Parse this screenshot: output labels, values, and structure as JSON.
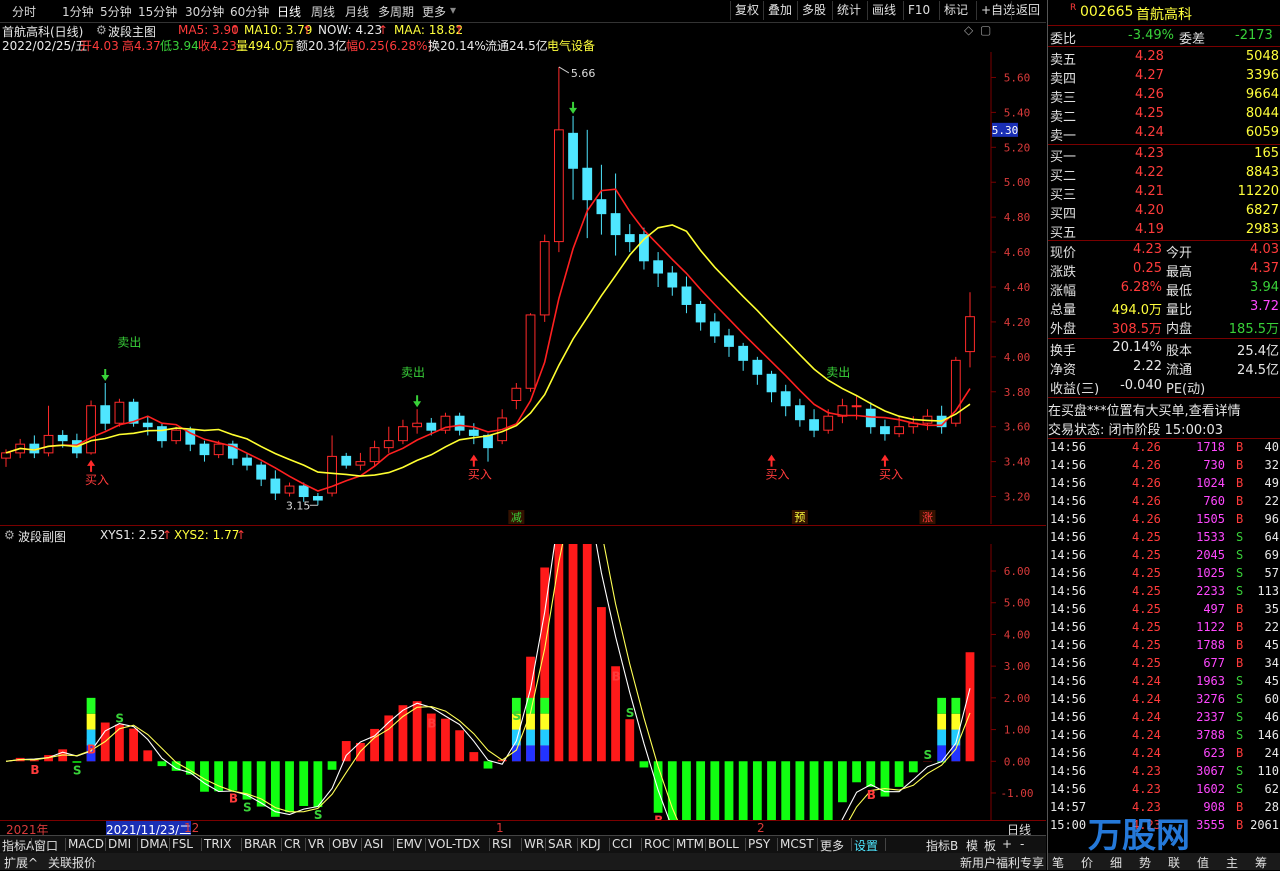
{
  "toolbar": {
    "periods": [
      "分时",
      "1分钟",
      "5分钟",
      "15分钟",
      "30分钟",
      "60分钟",
      "日线",
      "周线",
      "月线",
      "多周期",
      "更多"
    ],
    "buttons": [
      "复权",
      "叠加",
      "多股",
      "统计",
      "画线",
      "F10",
      "标记",
      "+自选",
      "返回"
    ]
  },
  "main_info": {
    "stock": "首航高科(日线)",
    "indicator": "波段主图",
    "ma5": "MA5: 3.90",
    "ma10": "MA10: 3.79",
    "now": "NOW: 4.23",
    "maa": "MAA: 18.82",
    "date": "2022/02/25/五",
    "open": "开4.03",
    "high": "高4.37",
    "low": "低3.94",
    "close": "收4.23",
    "vol": "量494.0万",
    "amount": "额20.3亿",
    "range": "幅0.25(6.28%)",
    "turnover": "换20.14%",
    "float": "流通24.5亿",
    "sector": "电气设备"
  },
  "main_chart": {
    "y_ticks": [
      "5.60",
      "5.40",
      "5.20",
      "5.00",
      "4.80",
      "4.60",
      "4.40",
      "4.20",
      "4.00",
      "3.80",
      "3.60",
      "3.40",
      "3.20"
    ],
    "crosshair_price": "5.30",
    "peak_label": "5.66",
    "low_label": "3.15",
    "sell_labels": [
      "卖出",
      "卖出",
      "卖出"
    ],
    "buy_labels": [
      "买入",
      "买入",
      "买入",
      "买入"
    ],
    "markers": [
      "减",
      "预",
      "涨"
    ]
  },
  "chart_data": {
    "type": "candlestick",
    "x": [
      "2021/11/23",
      "",
      "",
      "",
      "",
      "",
      "",
      "",
      "",
      "",
      "",
      "",
      "",
      "",
      "",
      "",
      "",
      "",
      "",
      "",
      "",
      "",
      "",
      "",
      "",
      "",
      "",
      "",
      "",
      "",
      "",
      "",
      "",
      "",
      "",
      "",
      "",
      "",
      "",
      "",
      "",
      "",
      "",
      "",
      "",
      "",
      "",
      "",
      "",
      "",
      "",
      "",
      "",
      "",
      "",
      "",
      "",
      "",
      "",
      "",
      "",
      "",
      "2022/02/25"
    ],
    "ylim": [
      3.1,
      5.7
    ],
    "candles": [
      [
        3.42,
        3.45,
        3.37,
        3.47
      ],
      [
        3.45,
        3.5,
        3.42,
        3.53
      ],
      [
        3.5,
        3.45,
        3.42,
        3.55
      ],
      [
        3.45,
        3.55,
        3.43,
        3.72
      ],
      [
        3.55,
        3.52,
        3.48,
        3.58
      ],
      [
        3.52,
        3.45,
        3.42,
        3.56
      ],
      [
        3.45,
        3.72,
        3.44,
        3.75
      ],
      [
        3.72,
        3.62,
        3.58,
        3.85
      ],
      [
        3.62,
        3.74,
        3.6,
        3.76
      ],
      [
        3.74,
        3.62,
        3.6,
        3.76
      ],
      [
        3.62,
        3.6,
        3.55,
        3.66
      ],
      [
        3.6,
        3.52,
        3.48,
        3.62
      ],
      [
        3.52,
        3.58,
        3.5,
        3.6
      ],
      [
        3.58,
        3.5,
        3.46,
        3.6
      ],
      [
        3.5,
        3.44,
        3.4,
        3.52
      ],
      [
        3.44,
        3.5,
        3.42,
        3.52
      ],
      [
        3.5,
        3.42,
        3.38,
        3.52
      ],
      [
        3.42,
        3.38,
        3.35,
        3.45
      ],
      [
        3.38,
        3.3,
        3.26,
        3.4
      ],
      [
        3.3,
        3.22,
        3.18,
        3.35
      ],
      [
        3.22,
        3.26,
        3.2,
        3.28
      ],
      [
        3.26,
        3.2,
        3.17,
        3.28
      ],
      [
        3.2,
        3.18,
        3.15,
        3.22
      ],
      [
        3.22,
        3.43,
        3.2,
        3.55
      ],
      [
        3.43,
        3.38,
        3.36,
        3.45
      ],
      [
        3.38,
        3.4,
        3.35,
        3.45
      ],
      [
        3.4,
        3.48,
        3.37,
        3.52
      ],
      [
        3.48,
        3.52,
        3.45,
        3.6
      ],
      [
        3.52,
        3.6,
        3.5,
        3.64
      ],
      [
        3.6,
        3.62,
        3.56,
        3.7
      ],
      [
        3.62,
        3.58,
        3.55,
        3.65
      ],
      [
        3.58,
        3.66,
        3.56,
        3.68
      ],
      [
        3.66,
        3.58,
        3.55,
        3.68
      ],
      [
        3.58,
        3.55,
        3.5,
        3.62
      ],
      [
        3.55,
        3.48,
        3.4,
        3.56
      ],
      [
        3.52,
        3.65,
        3.5,
        3.7
      ],
      [
        3.75,
        3.82,
        3.7,
        3.85
      ],
      [
        3.82,
        4.24,
        3.8,
        4.25
      ],
      [
        4.24,
        4.66,
        4.2,
        4.7
      ],
      [
        4.66,
        5.3,
        4.6,
        5.66
      ],
      [
        5.28,
        5.08,
        4.9,
        5.38
      ],
      [
        5.08,
        4.9,
        4.68,
        5.3
      ],
      [
        4.9,
        4.82,
        4.7,
        5.1
      ],
      [
        4.82,
        4.7,
        4.58,
        5.05
      ],
      [
        4.7,
        4.66,
        4.6,
        4.76
      ],
      [
        4.7,
        4.55,
        4.5,
        4.74
      ],
      [
        4.55,
        4.48,
        4.4,
        4.6
      ],
      [
        4.48,
        4.4,
        4.35,
        4.52
      ],
      [
        4.4,
        4.3,
        4.25,
        4.46
      ],
      [
        4.3,
        4.2,
        4.15,
        4.32
      ],
      [
        4.2,
        4.12,
        4.08,
        4.25
      ],
      [
        4.12,
        4.06,
        4.0,
        4.16
      ],
      [
        4.06,
        3.98,
        3.92,
        4.08
      ],
      [
        3.98,
        3.9,
        3.84,
        4.0
      ],
      [
        3.9,
        3.8,
        3.74,
        3.92
      ],
      [
        3.8,
        3.72,
        3.66,
        3.84
      ],
      [
        3.72,
        3.64,
        3.6,
        3.76
      ],
      [
        3.64,
        3.58,
        3.54,
        3.7
      ],
      [
        3.58,
        3.66,
        3.56,
        3.7
      ],
      [
        3.66,
        3.72,
        3.62,
        3.76
      ],
      [
        3.72,
        3.72,
        3.64,
        3.78
      ],
      [
        3.7,
        3.6,
        3.56,
        3.74
      ],
      [
        3.6,
        3.56,
        3.52,
        3.64
      ],
      [
        3.56,
        3.6,
        3.54,
        3.66
      ],
      [
        3.6,
        3.62,
        3.56,
        3.66
      ],
      [
        3.62,
        3.66,
        3.58,
        3.7
      ],
      [
        3.66,
        3.6,
        3.56,
        3.72
      ],
      [
        3.62,
        3.98,
        3.6,
        4.0
      ],
      [
        4.03,
        4.23,
        3.94,
        4.37
      ]
    ],
    "ma5_series": "red",
    "ma10_series": "yellow"
  },
  "sub_info": {
    "indicator": "波段副图",
    "xys1": "XYS1: 2.52",
    "xys2": "XYS2: 1.77",
    "y_ticks": [
      "6.00",
      "5.00",
      "4.00",
      "3.00",
      "2.00",
      "1.00",
      "0.00",
      "-1.00"
    ]
  },
  "x_axis": {
    "labels": [
      "2021年",
      "2021/11/23/二",
      "12",
      "1",
      "2"
    ],
    "period": "日线"
  },
  "tabs": [
    "指标A",
    "窗口",
    "MACD",
    "DMI",
    "DMA",
    "FSL",
    "TRIX",
    "BRAR",
    "CR",
    "VR",
    "OBV",
    "ASI",
    "EMV",
    "VOL-TDX",
    "RSI",
    "WR",
    "SAR",
    "KDJ",
    "CCI",
    "ROC",
    "MTM",
    "BOLL",
    "PSY",
    "MCST",
    "更多",
    "设置"
  ],
  "tabs_right": [
    "指标B",
    "模",
    "板",
    "+",
    "-"
  ],
  "status": {
    "left": [
      "扩展^",
      "关联报价"
    ],
    "right": "新用户福利专享",
    "right_icons": [
      "笔",
      "价",
      "细",
      "势",
      "联",
      "值",
      "主",
      "筹"
    ]
  },
  "quote": {
    "badge": "R",
    "code": "002665",
    "name": "首航高科",
    "webi": {
      "label": "委比",
      "value": "-3.49%",
      "label2": "委差",
      "value2": "-2173"
    },
    "asks": [
      {
        "label": "卖五",
        "price": "4.28",
        "vol": "5048"
      },
      {
        "label": "卖四",
        "price": "4.27",
        "vol": "3396"
      },
      {
        "label": "卖三",
        "price": "4.26",
        "vol": "9664"
      },
      {
        "label": "卖二",
        "price": "4.25",
        "vol": "8044"
      },
      {
        "label": "卖一",
        "price": "4.24",
        "vol": "6059"
      }
    ],
    "bids": [
      {
        "label": "买一",
        "price": "4.23",
        "vol": "165"
      },
      {
        "label": "买二",
        "price": "4.22",
        "vol": "8843"
      },
      {
        "label": "买三",
        "price": "4.21",
        "vol": "11220"
      },
      {
        "label": "买四",
        "price": "4.20",
        "vol": "6827"
      },
      {
        "label": "买五",
        "price": "4.19",
        "vol": "2983"
      }
    ],
    "stats": [
      {
        "l1": "现价",
        "v1": "4.23",
        "l2": "今开",
        "v2": "4.03",
        "c1": "red",
        "c2": "red"
      },
      {
        "l1": "涨跌",
        "v1": "0.25",
        "l2": "最高",
        "v2": "4.37",
        "c1": "red",
        "c2": "red"
      },
      {
        "l1": "涨幅",
        "v1": "6.28%",
        "l2": "最低",
        "v2": "3.94",
        "c1": "red",
        "c2": "green"
      },
      {
        "l1": "总量",
        "v1": "494.0万",
        "l2": "量比",
        "v2": "3.72",
        "c1": "yellow",
        "c2": "mag"
      },
      {
        "l1": "外盘",
        "v1": "308.5万",
        "l2": "内盘",
        "v2": "185.5万",
        "c1": "red",
        "c2": "green"
      }
    ],
    "stats2": [
      {
        "l1": "换手",
        "v1": "20.14%",
        "l2": "股本",
        "v2": "25.4亿"
      },
      {
        "l1": "净资",
        "v1": "2.22",
        "l2": "流通",
        "v2": "24.5亿"
      },
      {
        "l1": "收益(三)",
        "v1": "-0.040",
        "l2": "PE(动)",
        "v2": ""
      }
    ],
    "notice": "在买盘***位置有大买单,查看详情",
    "state": "交易状态: 闭市阶段 15:00:03",
    "ticks": [
      [
        "14:56",
        "4.26",
        "1718",
        "B",
        "40"
      ],
      [
        "14:56",
        "4.26",
        "730",
        "B",
        "32"
      ],
      [
        "14:56",
        "4.26",
        "1024",
        "B",
        "49"
      ],
      [
        "14:56",
        "4.26",
        "760",
        "B",
        "22"
      ],
      [
        "14:56",
        "4.26",
        "1505",
        "B",
        "96"
      ],
      [
        "14:56",
        "4.25",
        "1533",
        "S",
        "64"
      ],
      [
        "14:56",
        "4.25",
        "2045",
        "S",
        "69"
      ],
      [
        "14:56",
        "4.25",
        "1025",
        "S",
        "57"
      ],
      [
        "14:56",
        "4.25",
        "2233",
        "S",
        "113"
      ],
      [
        "14:56",
        "4.25",
        "497",
        "B",
        "35"
      ],
      [
        "14:56",
        "4.25",
        "1122",
        "B",
        "22"
      ],
      [
        "14:56",
        "4.25",
        "1788",
        "B",
        "45"
      ],
      [
        "14:56",
        "4.25",
        "677",
        "B",
        "34"
      ],
      [
        "14:56",
        "4.24",
        "1963",
        "S",
        "45"
      ],
      [
        "14:56",
        "4.24",
        "3276",
        "S",
        "60"
      ],
      [
        "14:56",
        "4.24",
        "2337",
        "S",
        "46"
      ],
      [
        "14:56",
        "4.24",
        "3788",
        "S",
        "146"
      ],
      [
        "14:56",
        "4.24",
        "623",
        "B",
        "24"
      ],
      [
        "14:56",
        "4.23",
        "3067",
        "S",
        "110"
      ],
      [
        "14:56",
        "4.23",
        "1602",
        "S",
        "62"
      ],
      [
        "14:57",
        "4.23",
        "908",
        "B",
        "28"
      ],
      [
        "15:00",
        "4.23",
        "3555",
        "B",
        "2061"
      ]
    ],
    "watermark": "万股网"
  }
}
